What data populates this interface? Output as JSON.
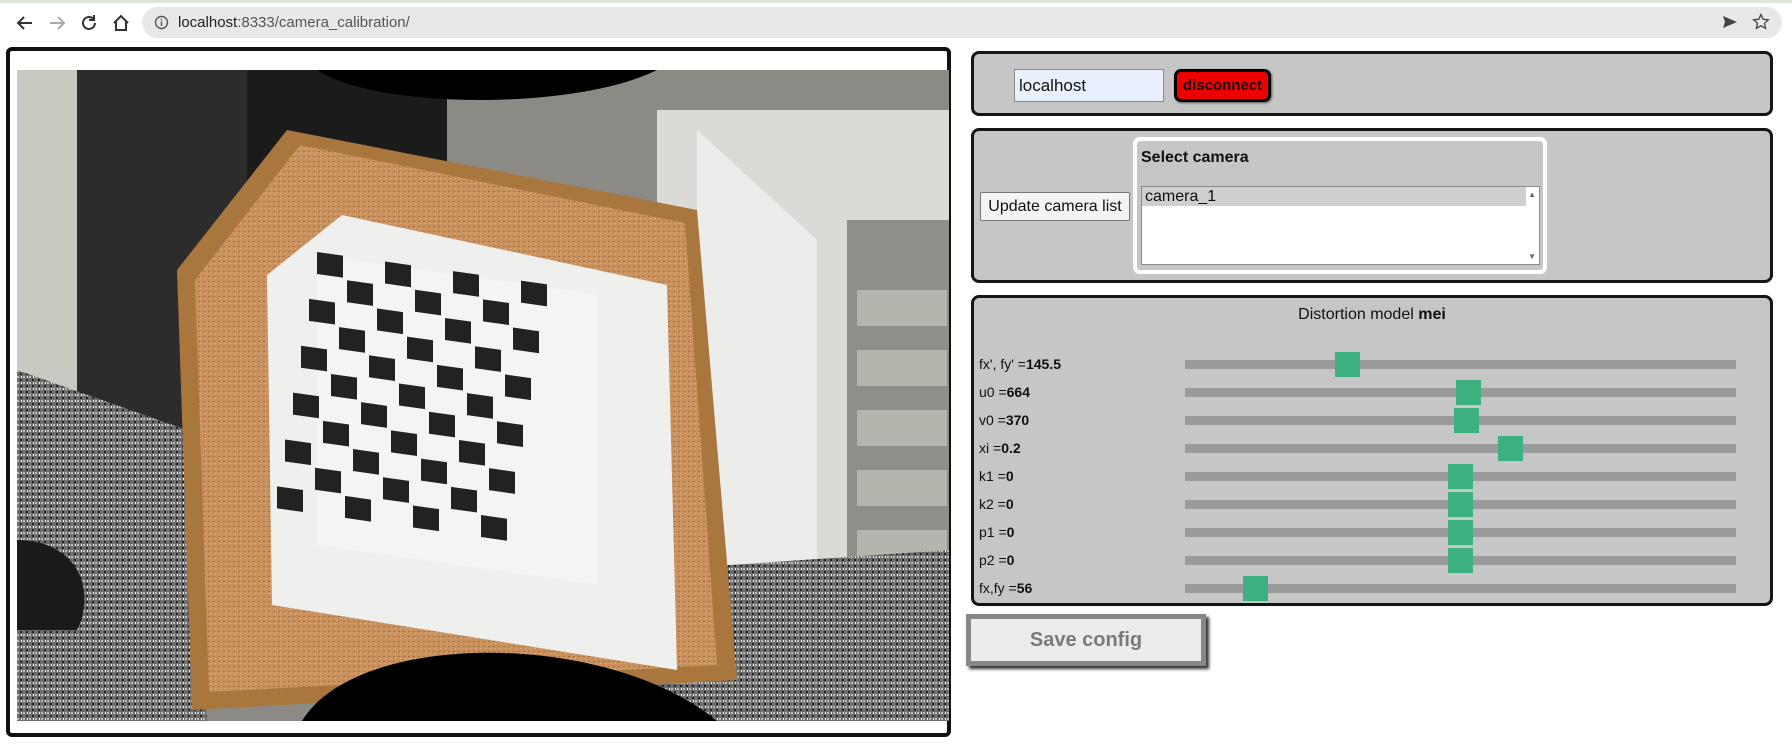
{
  "browser": {
    "url_host": "localhost",
    "url_port_path": ":8333/camera_calibration/"
  },
  "connection": {
    "host_value": "localhost",
    "disconnect_label": "disconnect",
    "disconnect_color": "#ee0000"
  },
  "camera_select": {
    "update_label": "Update camera list",
    "title": "Select camera",
    "options": [
      "camera_1"
    ],
    "selected": "camera_1"
  },
  "distortion": {
    "title_prefix": "Distortion model",
    "model": "mei",
    "thumb_color": "#3cb07e",
    "params": [
      {
        "label": "fx', fy' =",
        "value": "145.5",
        "slider_fraction": 0.285
      },
      {
        "label": "u0 =",
        "value": "664",
        "slider_fraction": 0.515
      },
      {
        "label": "v0 =",
        "value": "370",
        "slider_fraction": 0.512
      },
      {
        "label": "xi =",
        "value": "0.2",
        "slider_fraction": 0.595
      },
      {
        "label": "k1 =",
        "value": "0",
        "slider_fraction": 0.5
      },
      {
        "label": "k2 =",
        "value": "0",
        "slider_fraction": 0.5
      },
      {
        "label": "p1 =",
        "value": "0",
        "slider_fraction": 0.5
      },
      {
        "label": "p2 =",
        "value": "0",
        "slider_fraction": 0.5
      },
      {
        "label": "fx,fy =",
        "value": "56",
        "slider_fraction": 0.11
      }
    ]
  },
  "save_label": "Save config"
}
